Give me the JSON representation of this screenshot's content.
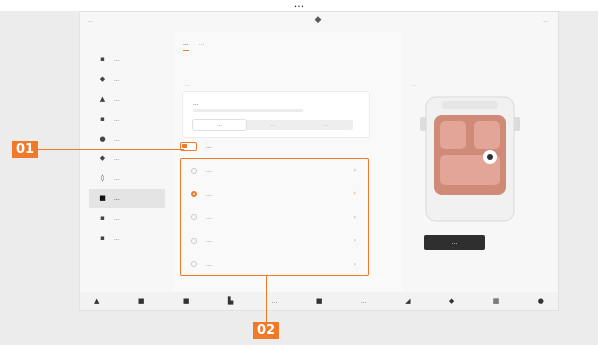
{
  "caption": "...",
  "status_bar": {
    "left_text": "...",
    "right_text": "...",
    "center_icon": "car-icon"
  },
  "sidebar": {
    "items": [
      {
        "label": "...",
        "icon": "glyph-icon-1"
      },
      {
        "label": "...",
        "icon": "glyph-icon-2"
      },
      {
        "label": "...",
        "icon": "glyph-icon-3"
      },
      {
        "label": "...",
        "icon": "glyph-icon-4"
      },
      {
        "label": "...",
        "icon": "glyph-icon-5"
      },
      {
        "label": "...",
        "icon": "glyph-icon-6"
      },
      {
        "label": "...",
        "icon": "glyph-icon-7"
      },
      {
        "label": "...",
        "icon": "glyph-icon-8"
      },
      {
        "label": "...",
        "icon": "glyph-icon-9"
      },
      {
        "label": "...",
        "icon": "glyph-icon-10"
      }
    ],
    "active_index": 7
  },
  "main": {
    "tabs": [
      "...",
      "..."
    ],
    "active_tab": 0,
    "section_label": "...",
    "card": {
      "title": "...",
      "segments": [
        "...",
        "...",
        "..."
      ],
      "selected_segment": 0
    },
    "toggle": {
      "label": "...",
      "on": true
    },
    "options": [
      {
        "label": "...",
        "selected": false
      },
      {
        "label": "...",
        "selected": true
      },
      {
        "label": "...",
        "selected": false
      },
      {
        "label": "...",
        "selected": false
      },
      {
        "label": "...",
        "selected": false
      }
    ]
  },
  "preview": {
    "label": "...",
    "apply_button": "..."
  },
  "dock": {
    "temp_left": "...",
    "temp_right": "...",
    "icons": [
      "home-icon",
      "car-icon",
      "car-front-icon",
      "seat-icon",
      "fan-icon",
      "volume-icon",
      "apps-icon",
      "grid-icon",
      "person-icon"
    ]
  },
  "callouts": {
    "one": "01",
    "two": "02"
  },
  "colors": {
    "accent": "#f07a2a",
    "background": "#f7f7f7",
    "button": "#2f2f2f",
    "car_interior": "#d08a78"
  }
}
